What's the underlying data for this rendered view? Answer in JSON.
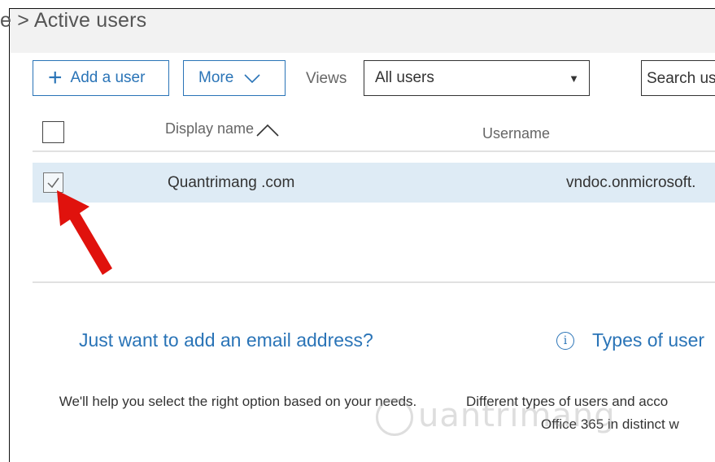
{
  "header": {
    "breadcrumb": "e > Active users"
  },
  "toolbar": {
    "add_user_label": "Add a user",
    "more_label": "More",
    "views_label": "Views",
    "views_selected": "All users",
    "search_placeholder": "Search us"
  },
  "table": {
    "columns": [
      "Display name",
      "Username"
    ],
    "rows": [
      {
        "display_name": "Quantrimang .com",
        "username": "vndoc.onmicrosoft.",
        "selected": true
      }
    ]
  },
  "promo": {
    "left_title": "Just want to add an email address?",
    "left_text": "We'll help you select the right option based on your needs.",
    "right_title": "Types of user",
    "right_text_1": "Different types of users and acco",
    "right_text_2": "Office 365 in distinct w"
  },
  "watermark": "uantrimang",
  "colors": {
    "accent": "#2a74b7",
    "selected_row": "#deebf5",
    "pointer_arrow": "#e0120d"
  }
}
